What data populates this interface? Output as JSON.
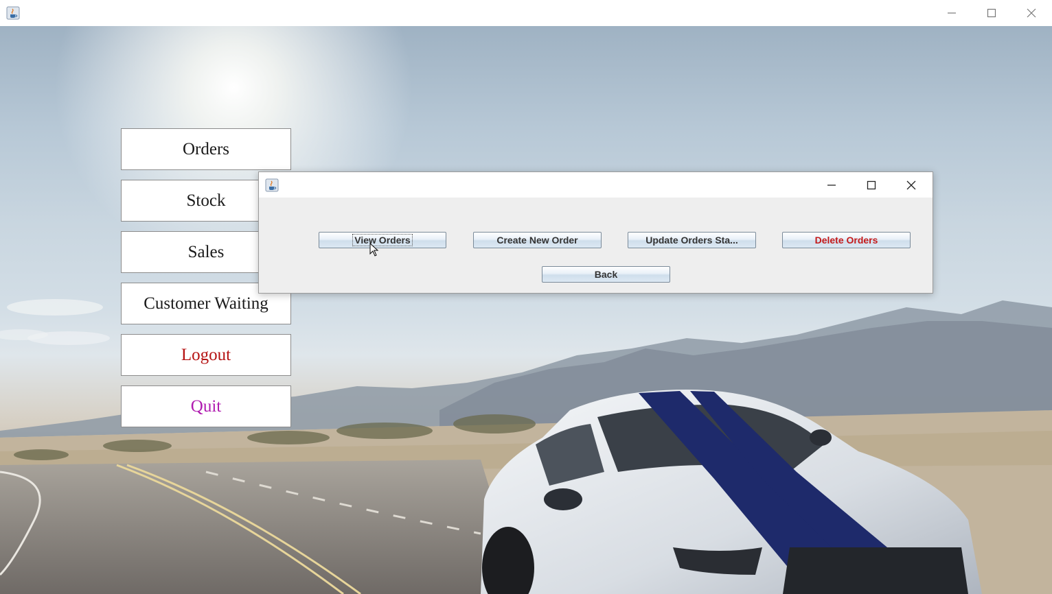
{
  "main_window": {
    "title": "",
    "controls": {
      "minimize": "—",
      "maximize": "☐",
      "close": "✕"
    }
  },
  "menu": {
    "items": [
      {
        "label": "Orders",
        "color": "#1a1a1a"
      },
      {
        "label": "Stock",
        "color": "#1a1a1a"
      },
      {
        "label": "Sales",
        "color": "#1a1a1a"
      },
      {
        "label": "Customer Waiting",
        "color": "#1a1a1a"
      },
      {
        "label": "Logout",
        "color": "#b51212"
      },
      {
        "label": "Quit",
        "color": "#b01bb0"
      }
    ]
  },
  "dialog": {
    "title": "",
    "buttons": {
      "view_orders": "View Orders",
      "create_new_order": "Create New Order",
      "update_orders_status": "Update Orders Sta...",
      "delete_orders": "Delete Orders",
      "back": "Back"
    },
    "delete_color": "#c41a1a"
  },
  "icons": {
    "app": "java-cup-icon",
    "background": "sports-car-on-desert-road"
  }
}
